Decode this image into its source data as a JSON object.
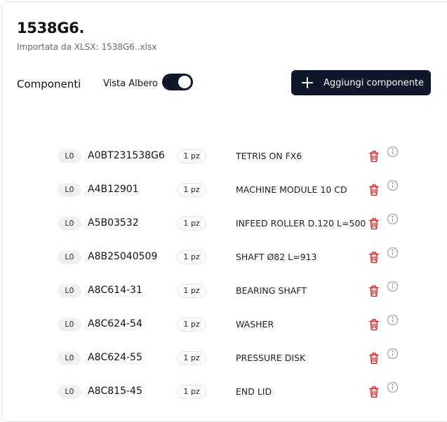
{
  "header": {
    "title": "1538G6.",
    "subtitle": "Importata da XLSX: 1538G6..xlsx"
  },
  "toolbar": {
    "components_label": "Componenti",
    "tree_view_label": "Vista Albero",
    "tree_view_enabled": true,
    "add_button_label": "Aggiungi componente"
  },
  "colors": {
    "primary": "#0f172a",
    "danger": "#dc2626",
    "muted": "#9ca3af"
  },
  "components": [
    {
      "level": "L0",
      "code": "A0BT231538G6",
      "qty": "1 pz",
      "description": "TETRIS ON FX6"
    },
    {
      "level": "L0",
      "code": "A4B12901",
      "qty": "1 pz",
      "description": "MACHINE MODULE 10 CD"
    },
    {
      "level": "L0",
      "code": "A5B03532",
      "qty": "1 pz",
      "description": "INFEED ROLLER D.120 L=500"
    },
    {
      "level": "L0",
      "code": "A8B25040509",
      "qty": "1 pz",
      "description": "SHAFT Ø82 L=913"
    },
    {
      "level": "L0",
      "code": "A8C614-31",
      "qty": "1 pz",
      "description": "BEARING SHAFT"
    },
    {
      "level": "L0",
      "code": "A8C624-54",
      "qty": "1 pz",
      "description": "WASHER"
    },
    {
      "level": "L0",
      "code": "A8C624-55",
      "qty": "1 pz",
      "description": "PRESSURE DISK"
    },
    {
      "level": "L0",
      "code": "A8C815-45",
      "qty": "1 pz",
      "description": "END LID"
    }
  ]
}
